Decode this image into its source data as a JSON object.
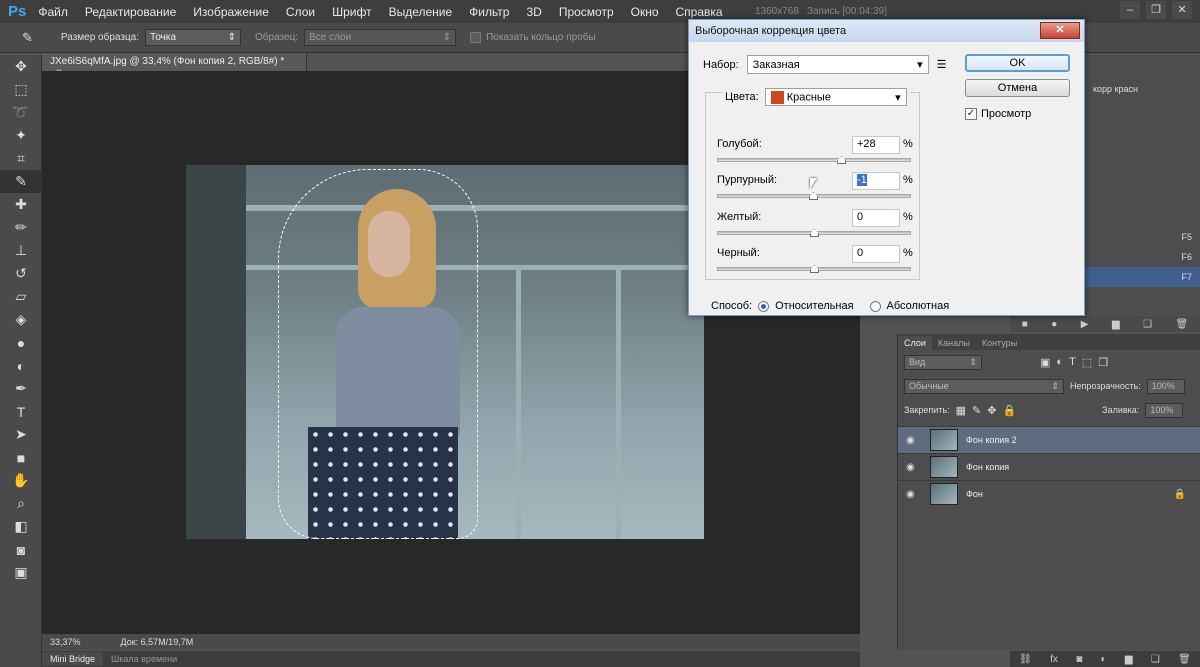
{
  "menubar": {
    "logo": "Ps",
    "items": [
      "Файл",
      "Редактирование",
      "Изображение",
      "Слои",
      "Шрифт",
      "Выделение",
      "Фильтр",
      "3D",
      "Просмотр",
      "Окно",
      "Справка"
    ],
    "screen_size": "1360x768",
    "recording": "Запись [00:04:39]"
  },
  "options": {
    "sample_size_label": "Размер образца:",
    "sample_size_value": "Точка",
    "sample_label": "Образец:",
    "sample_value": "Все слои",
    "show_ring_label": "Показать кольцо пробы"
  },
  "document": {
    "tab_title": "JXe6iS6qMfA.jpg @ 33,4% (Фон копия 2, RGB/8#) *",
    "zoom": "33,37%",
    "doc_size": "Док: 6,57M/19,7M"
  },
  "bottom_tabs": [
    "Mini Bridge",
    "Шкала времени"
  ],
  "dialog": {
    "title": "Выборочная коррекция цвета",
    "preset_label": "Набор:",
    "preset_value": "Заказная",
    "ok_label": "OK",
    "cancel_label": "Отмена",
    "preview_label": "Просмотр",
    "preview_checked": true,
    "colors_label": "Цвета:",
    "colors_value": "Красные",
    "colors_swatch": "#cc4a18",
    "sliders": [
      {
        "label": "Голубой:",
        "value": "+28",
        "pct": "%",
        "level": 28
      },
      {
        "label": "Пурпурный:",
        "value": "-1",
        "pct": "%",
        "level": -1
      },
      {
        "label": "Желтый:",
        "value": "0",
        "pct": "%",
        "level": 0
      },
      {
        "label": "Черный:",
        "value": "0",
        "pct": "%",
        "level": 0
      }
    ],
    "method_label": "Способ:",
    "method_relative": "Относительная",
    "method_absolute": "Абсолютная",
    "method_selected": "relative"
  },
  "right_panel": {
    "partial_text": "корр красн",
    "shortcuts": [
      "F5",
      "F6",
      "F7"
    ]
  },
  "layers_panel": {
    "tabs": [
      "Слои",
      "Каналы",
      "Контуры"
    ],
    "kind_filter": "Вид",
    "blend_mode": "Обычные",
    "opacity_label": "Непрозрачность:",
    "opacity_value": "100%",
    "lock_label": "Закрепить:",
    "fill_label": "Заливка:",
    "fill_value": "100%",
    "layers": [
      {
        "name": "Фон копия 2",
        "selected": true,
        "locked": false
      },
      {
        "name": "Фон копия",
        "selected": false,
        "locked": false
      },
      {
        "name": "Фон",
        "selected": false,
        "locked": true
      }
    ]
  }
}
